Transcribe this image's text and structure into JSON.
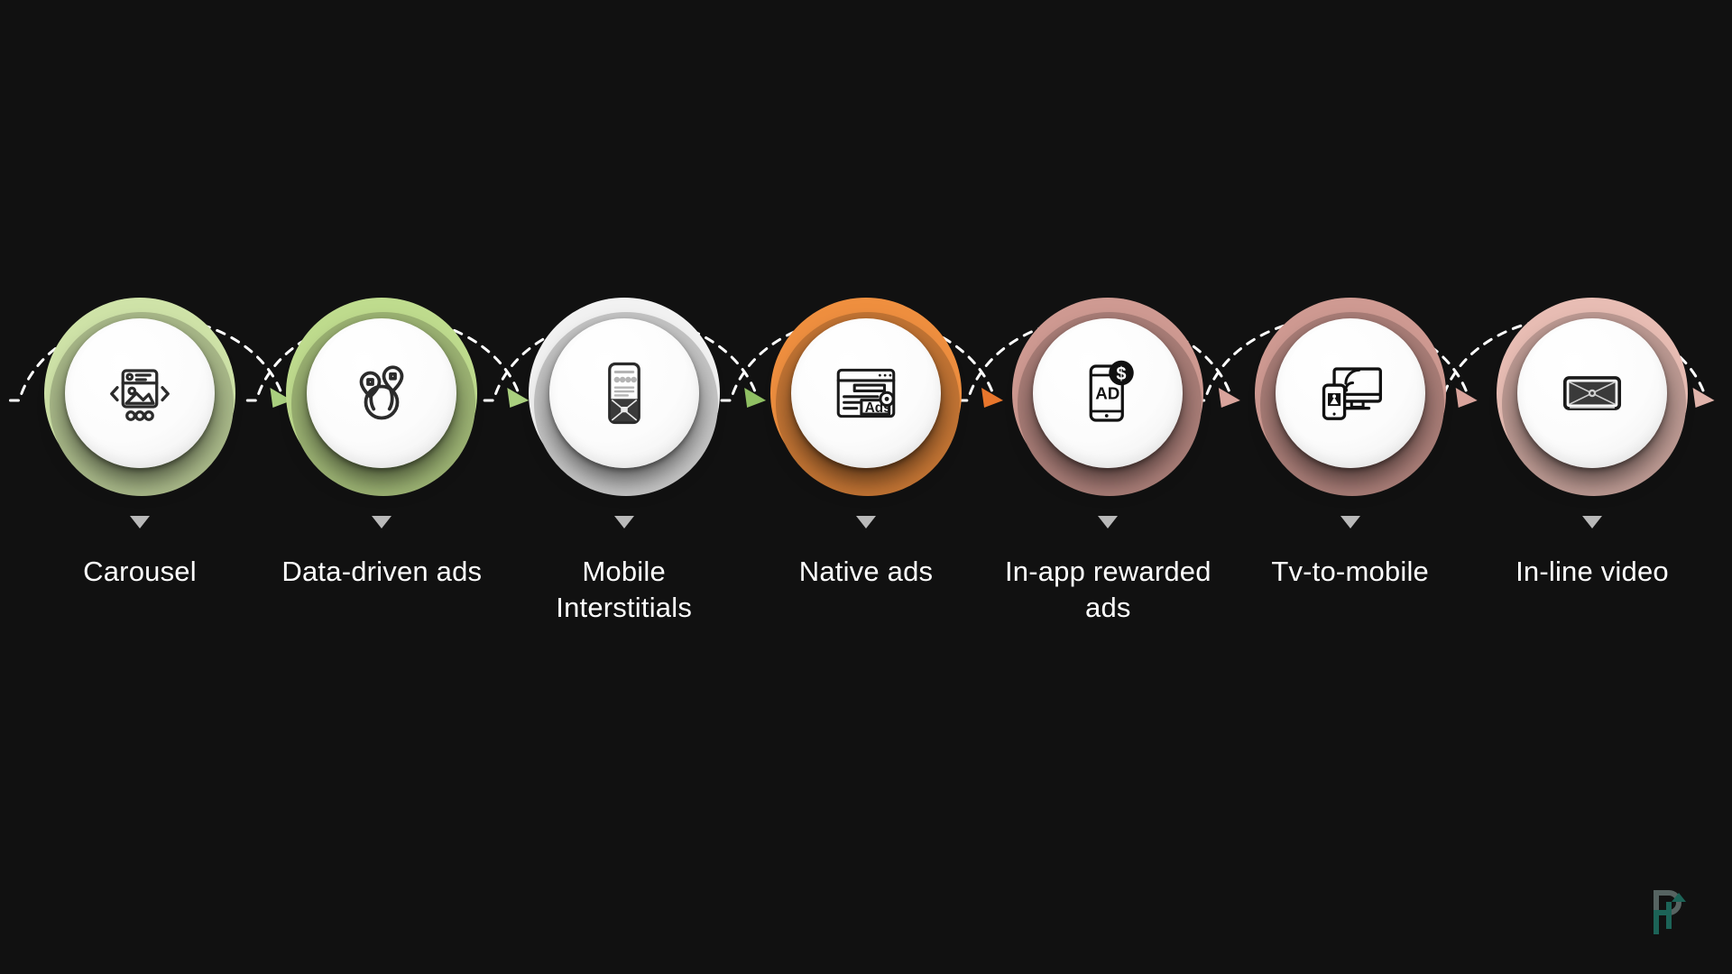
{
  "background_color": "#111111",
  "title_text_color": "#ffffff",
  "pointer_color": "#b9b9b9",
  "arrow_dash_color": "#ffffff",
  "logo": {
    "name": "p-arrow-logo",
    "color_primary": "#1d6b5e",
    "color_secondary": "#5c6a68"
  },
  "steps": [
    {
      "id": "carousel",
      "label": "Carousel",
      "ring_color": "#cfe3a8",
      "arrow_head_color": "#a9cf7e",
      "icon_name": "carousel-icon"
    },
    {
      "id": "data-driven-ads",
      "label": "Data-driven ads",
      "ring_color": "#bfdc8e",
      "arrow_head_color": "#a9cf7e",
      "icon_name": "location-pins-icon"
    },
    {
      "id": "mobile-interstitials",
      "label": "Mobile Interstitials",
      "ring_color": "#f2f2f2",
      "arrow_head_color": "#8fbf63",
      "icon_name": "mobile-interstitial-icon"
    },
    {
      "id": "native-ads",
      "label": "Native ads",
      "ring_color": "#ef8f3f",
      "arrow_head_color": "#e8762c",
      "icon_name": "browser-ads-icon"
    },
    {
      "id": "in-app-rewarded-ads",
      "label": "In-app rewarded ads",
      "ring_color": "#cf9a92",
      "arrow_head_color": "#d9a49c",
      "icon_name": "phone-ad-coin-icon"
    },
    {
      "id": "tv-to-mobile",
      "label": "Tv-to-mobile",
      "ring_color": "#cf9a92",
      "arrow_head_color": "#d9a49c",
      "icon_name": "tv-phone-cast-icon"
    },
    {
      "id": "in-line-video",
      "label": "In-line video",
      "ring_color": "#e8bdb4",
      "arrow_head_color": "#e0b3aa",
      "icon_name": "inline-video-icon"
    }
  ]
}
